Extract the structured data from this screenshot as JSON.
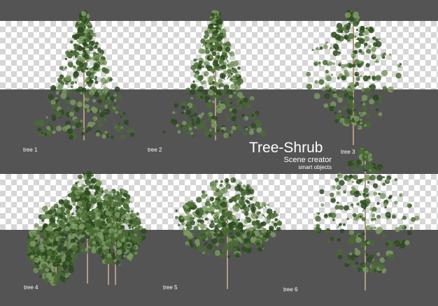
{
  "title": {
    "main": "Tree-Shrub",
    "line2": "Scene creator",
    "line3": "smart objects"
  },
  "trees": [
    {
      "label": "tree 1",
      "style": "conifer"
    },
    {
      "label": "tree 2",
      "style": "conifer"
    },
    {
      "label": "tree 3",
      "style": "sparse"
    },
    {
      "label": "tree 4",
      "style": "shrub-cluster"
    },
    {
      "label": "tree 5",
      "style": "round"
    },
    {
      "label": "tree 6",
      "style": "sparse"
    }
  ],
  "colors": {
    "background": "#545454",
    "checker_light": "#ffffff",
    "checker_dark": "#d6d6d6",
    "foliage_dark": "#2c4a1f",
    "foliage_mid": "#4a6b35",
    "foliage_light": "#7d9963",
    "trunk": "#b49a82",
    "label_text": "#ffffff"
  }
}
